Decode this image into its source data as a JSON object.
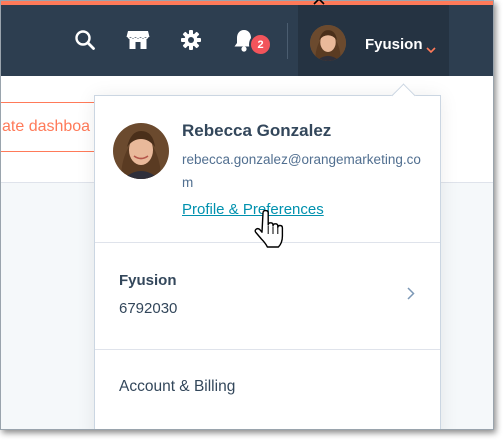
{
  "topbar": {
    "notification_count": "2",
    "account_name": "Fyusion"
  },
  "background": {
    "button_label": "ate dashboa"
  },
  "dropdown": {
    "user_name": "Rebecca Gonzalez",
    "user_email": "rebecca.gonzalez@orangemarketing.com",
    "profile_link": "Profile & Preferences",
    "portal_name": "Fyusion",
    "portal_id": "6792030",
    "account_billing": "Account & Billing",
    "next_item": ""
  },
  "colors": {
    "topbar": "#2d3e50",
    "accent": "#ff7a59",
    "link": "#0091ae",
    "badge": "#f2545b"
  }
}
